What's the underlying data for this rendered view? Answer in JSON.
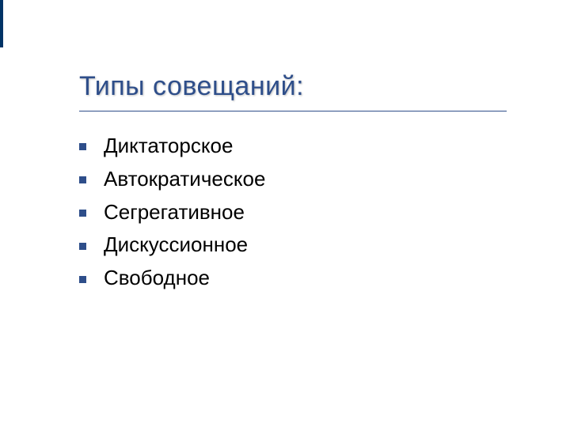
{
  "title": "Типы совещаний:",
  "bullets": [
    "Диктаторское",
    "Автократическое",
    "Сегрегативное",
    "Дискуссионное",
    "Свободное"
  ],
  "colors": {
    "accent": "#2e4e8a",
    "text": "#000000"
  }
}
